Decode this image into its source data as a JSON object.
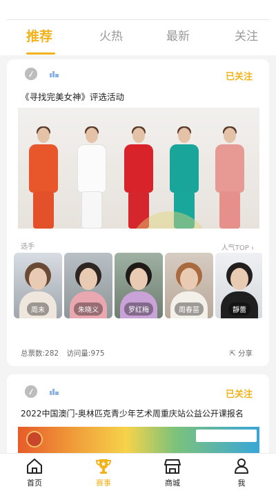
{
  "tabs": {
    "recommend": "推荐",
    "hot": "火热",
    "latest": "最新",
    "follow": "关注"
  },
  "posts": [
    {
      "follow_label": "已关注",
      "title": "《寻找完美女神》评选活动",
      "contestants_label": "选手",
      "popularity_label": "人气TOP",
      "contestants": [
        "周未",
        "朱晓义",
        "罗红梅",
        "周春苗",
        "靜蕾"
      ],
      "total_votes": "总票数:282",
      "visits": "访问量:975",
      "share_label": "分享"
    },
    {
      "follow_label": "已关注",
      "title": "2022中国澳门-奥林匹克青少年艺术周重庆站公益公开课报名"
    }
  ],
  "nav": {
    "home": "首页",
    "contest": "赛事",
    "mall": "商城",
    "me": "我"
  },
  "colors": {
    "accent": "#f2b21c",
    "muted": "#9a9a9a"
  }
}
